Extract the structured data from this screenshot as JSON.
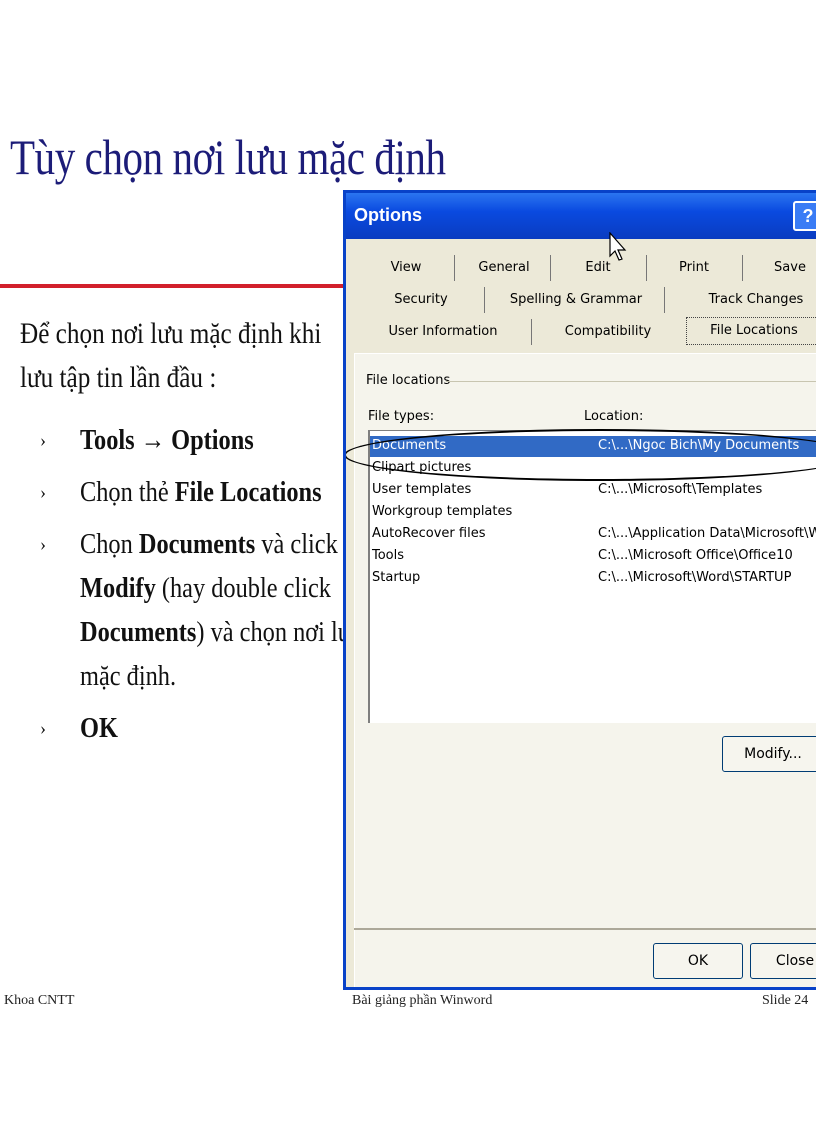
{
  "slide": {
    "title": "Tùy chọn nơi lưu mặc định",
    "intro_line1": "Để chọn nơi lưu mặc định khi",
    "intro_line2": "lưu tập tin lần đầu :",
    "bullet_mark": "›",
    "bullets": {
      "b1": {
        "bold1": "Tools",
        "arrow": " → ",
        "bold2": "Options"
      },
      "b2": {
        "text1": "Chọn thẻ ",
        "bold1": "File Locations"
      },
      "b3": {
        "text1": "Chọn ",
        "bold1": "Documents",
        "text2": " và click",
        "bold2": "Modify",
        "text3": " (hay double click",
        "bold3": "Documents",
        "text4": ") và chọn nơi lưu",
        "text5": "mặc định."
      },
      "b4": {
        "bold1": "OK"
      }
    },
    "footer": {
      "left": "Khoa CNTT",
      "center": "Bài giảng phần Winword",
      "right": "Slide 24"
    }
  },
  "dialog": {
    "title": "Options",
    "help": "?",
    "tabs_row1": [
      "View",
      "General",
      "Edit",
      "Print",
      "Save"
    ],
    "tabs_row2": [
      "Security",
      "Spelling & Grammar",
      "Track Changes"
    ],
    "tabs_row3": [
      "User Information",
      "Compatibility",
      "File Locations"
    ],
    "active_tab": "File Locations",
    "group_label": "File locations",
    "col_file_types": "File types:",
    "col_location": "Location:",
    "rows": [
      {
        "type": "Documents",
        "location": "C:\\...\\Ngoc Bich\\My Documents",
        "selected": true
      },
      {
        "type": "Clipart pictures",
        "location": ""
      },
      {
        "type": "User templates",
        "location": "C:\\...\\Microsoft\\Templates"
      },
      {
        "type": "Workgroup templates",
        "location": ""
      },
      {
        "type": "AutoRecover files",
        "location": "C:\\...\\Application Data\\Microsoft\\Word"
      },
      {
        "type": "Tools",
        "location": "C:\\...\\Microsoft Office\\Office10"
      },
      {
        "type": "Startup",
        "location": "C:\\...\\Microsoft\\Word\\STARTUP"
      }
    ],
    "modify_label": "Modify...",
    "ok_label": "OK",
    "close_label": "Close"
  },
  "colors": {
    "title_blue": "#1c1c78",
    "rule_red": "#d21f2b",
    "titlebar_blue": "#0a4ae0",
    "selection": "#316ac5"
  }
}
